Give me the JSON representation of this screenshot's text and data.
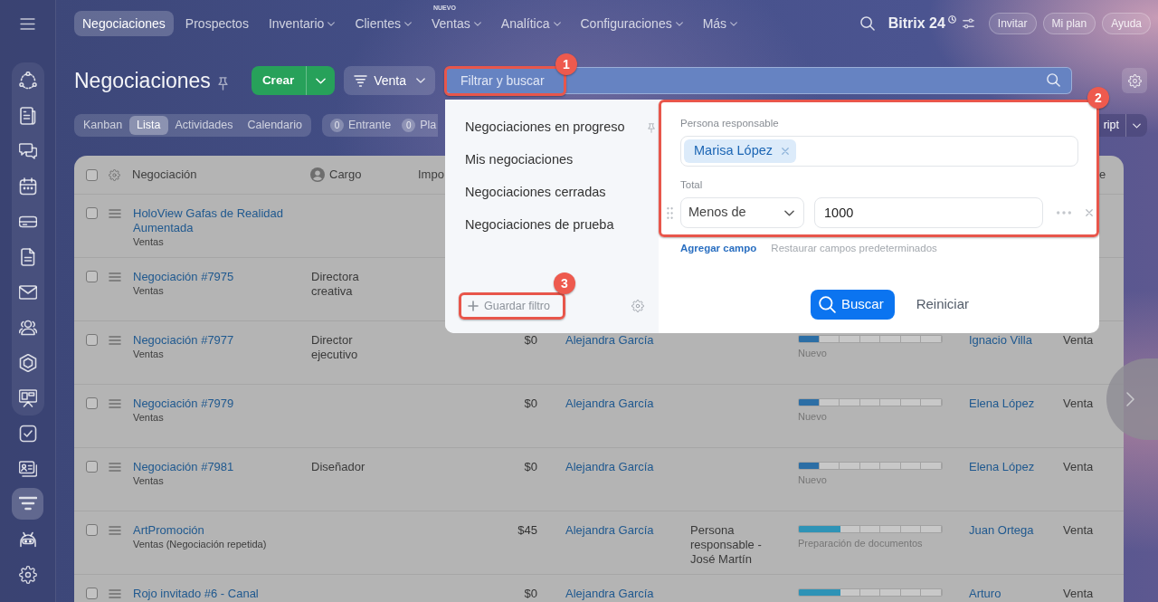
{
  "top_nav": {
    "tabs": [
      {
        "label": "Negociaciones",
        "selected": true,
        "has_menu": false
      },
      {
        "label": "Prospectos",
        "selected": false,
        "has_menu": false
      },
      {
        "label": "Inventario",
        "selected": false,
        "has_menu": true
      },
      {
        "label": "Clientes",
        "selected": false,
        "has_menu": true
      },
      {
        "label": "Ventas",
        "selected": false,
        "has_menu": true,
        "badge": "NUEVO"
      },
      {
        "label": "Analítica",
        "selected": false,
        "has_menu": true
      },
      {
        "label": "Configuraciones",
        "selected": false,
        "has_menu": true
      },
      {
        "label": "Más",
        "selected": false,
        "has_menu": true
      }
    ],
    "brand": "Bitrix 24",
    "buttons": [
      "Invitar",
      "Mi plan",
      "Ayuda"
    ]
  },
  "sidebar": {
    "group_items": [
      {
        "selected": false
      },
      {
        "selected": false
      },
      {
        "selected": false
      },
      {
        "selected": false
      },
      {
        "selected": false
      },
      {
        "selected": false
      },
      {
        "selected": false
      },
      {
        "selected": false
      },
      {
        "selected": false
      },
      {
        "selected": false
      }
    ],
    "items": [
      {
        "selected": false
      },
      {
        "selected": false
      },
      {
        "selected": true
      },
      {
        "selected": false
      },
      {
        "selected": false
      }
    ]
  },
  "toolbar": {
    "title": "Negociaciones",
    "create_button": "Crear",
    "category_button": "Venta",
    "filter": {
      "placeholder": "Filtrar y buscar",
      "annotation": "1"
    }
  },
  "view_tabs": [
    {
      "label": "Kanban",
      "selected": false
    },
    {
      "label": "Lista",
      "selected": true
    },
    {
      "label": "Actividades",
      "selected": false
    },
    {
      "label": "Calendario",
      "selected": false
    }
  ],
  "counters": [
    {
      "count": "0",
      "label": "Entrante"
    },
    {
      "count": "0",
      "label": "Pla"
    }
  ],
  "right_button": {
    "label": "ript"
  },
  "table": {
    "select_all_checked": false,
    "columns": [
      "Negociación",
      "Cargo",
      "Impo",
      "e"
    ],
    "rows": [
      {
        "checked": false,
        "title": "HoloView Gafas de Realidad Aumentada",
        "category": "Ventas"
      },
      {
        "checked": false,
        "title": "Negociación #7975",
        "category": "Ventas",
        "cargo": "Directora creativa"
      },
      {
        "checked": false,
        "title": "Negociación #7977",
        "category": "Ventas",
        "cargo": "Director ejecutivo",
        "amount": "$0",
        "responsible": "Alejandra García",
        "stage": {
          "label": "Nuevo",
          "level": 0.14,
          "color": "#2c6ea5"
        },
        "contact": "Ignacio Villa",
        "type": "Venta"
      },
      {
        "checked": false,
        "title": "Negociación #7979",
        "category": "Ventas",
        "amount": "$0",
        "responsible": "Alejandra García",
        "stage": {
          "label": "Nuevo",
          "level": 0.14,
          "color": "#2c6ea5"
        },
        "contact": "Elena López",
        "type": "Venta"
      },
      {
        "checked": false,
        "title": "Negociación #7981",
        "category": "Ventas",
        "cargo": "Diseñador",
        "amount": "$0",
        "responsible": "Alejandra García",
        "stage": {
          "label": "Nuevo",
          "level": 0.14,
          "color": "#2c6ea5"
        },
        "contact": "Elena López",
        "type": "Venta"
      },
      {
        "checked": false,
        "title": "ArtPromoción",
        "category": "Ventas (Negociación repetida)",
        "amount": "$45",
        "responsible": "Alejandra García",
        "column_6": "Persona responsable - José Martín",
        "stage": {
          "label": "Preparación de documentos",
          "level": 0.29,
          "color": "#2e93b6"
        },
        "contact": "Juan Ortega",
        "type": "Venta"
      },
      {
        "checked": false,
        "title": "Rojo invitado #6 - Canal",
        "amount": "$0",
        "responsible": "Alejandra García",
        "stage": {
          "level": 0.29,
          "color": "#2e93b6"
        },
        "contact": "Arturo",
        "type": "Venta"
      }
    ]
  },
  "filter_popup": {
    "presets": [
      {
        "label": "Negociaciones en progreso",
        "pinned": true
      },
      {
        "label": "Mis negociaciones",
        "pinned": false
      },
      {
        "label": "Negociaciones cerradas",
        "pinned": false
      },
      {
        "label": "Negociaciones de prueba",
        "pinned": false
      }
    ],
    "save_filter": {
      "label": "Guardar filtro",
      "annotation": "3"
    },
    "fields_annotation": "2",
    "fields": [
      {
        "kind": "people",
        "label": "Persona responsable",
        "tags": [
          "Marisa López"
        ]
      },
      {
        "kind": "number",
        "label": "Total",
        "operator": "Menos de",
        "value": "1000"
      }
    ],
    "add_field": "Agregar campo",
    "restore_fields": "Restaurar campos predeterminados",
    "search_button": "Buscar",
    "reset_button": "Reiniciar"
  }
}
